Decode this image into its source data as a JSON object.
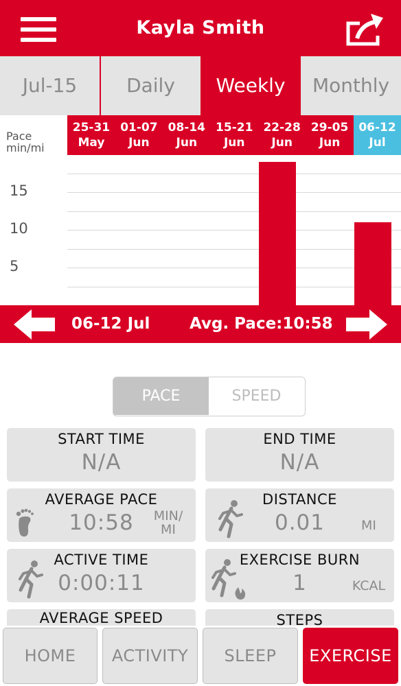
{
  "header": {
    "title": "Kayla Smith"
  },
  "tabs": [
    {
      "label": "Jul-15"
    },
    {
      "label": "Daily"
    },
    {
      "label": "Weekly"
    },
    {
      "label": "Monthly"
    }
  ],
  "chart_data": {
    "type": "bar",
    "ylabel_line1": "Pace",
    "ylabel_line2": "min/mi",
    "categories": [
      {
        "line1": "25-31",
        "line2": "May"
      },
      {
        "line1": "01-07",
        "line2": "Jun"
      },
      {
        "line1": "08-14",
        "line2": "Jun"
      },
      {
        "line1": "15-21",
        "line2": "Jun"
      },
      {
        "line1": "22-28",
        "line2": "Jun"
      },
      {
        "line1": "29-05",
        "line2": "Jun"
      },
      {
        "line1": "06-12",
        "line2": "Jul"
      }
    ],
    "values": [
      0,
      0,
      0,
      0,
      19,
      0,
      10.97
    ],
    "yticks": [
      "15",
      "10",
      "5"
    ],
    "ylim": [
      0,
      19
    ],
    "grid": true,
    "selected_index": 6
  },
  "navbar": {
    "week": "06-12 Jul",
    "avg_pace": "Avg. Pace:10:58"
  },
  "toggle": {
    "pace": "PACE",
    "speed": "SPEED"
  },
  "stats": {
    "start_time": {
      "title": "START TIME",
      "value": "N/A"
    },
    "end_time": {
      "title": "END TIME",
      "value": "N/A"
    },
    "average_pace": {
      "title": "AVERAGE PACE",
      "value": "10:58",
      "unit_line1": "MIN/",
      "unit_line2": "MI"
    },
    "distance": {
      "title": "DISTANCE",
      "value": "0.01",
      "unit": "MI"
    },
    "active_time": {
      "title": "ACTIVE TIME",
      "value": "0:00:11"
    },
    "exercise_burn": {
      "title": "EXERCISE BURN",
      "value": "1",
      "unit": "KCAL"
    },
    "average_speed": {
      "title": "AVERAGE SPEED"
    },
    "steps": {
      "title": "STEPS"
    }
  },
  "bottom_nav": [
    {
      "label": "HOME"
    },
    {
      "label": "ACTIVITY"
    },
    {
      "label": "SLEEP"
    },
    {
      "label": "EXERCISE"
    }
  ],
  "colors": {
    "brand": "#d90025",
    "current_week": "#4bbfe0",
    "card_bg": "#e4e4e4",
    "muted_text": "#8a8a8a"
  }
}
